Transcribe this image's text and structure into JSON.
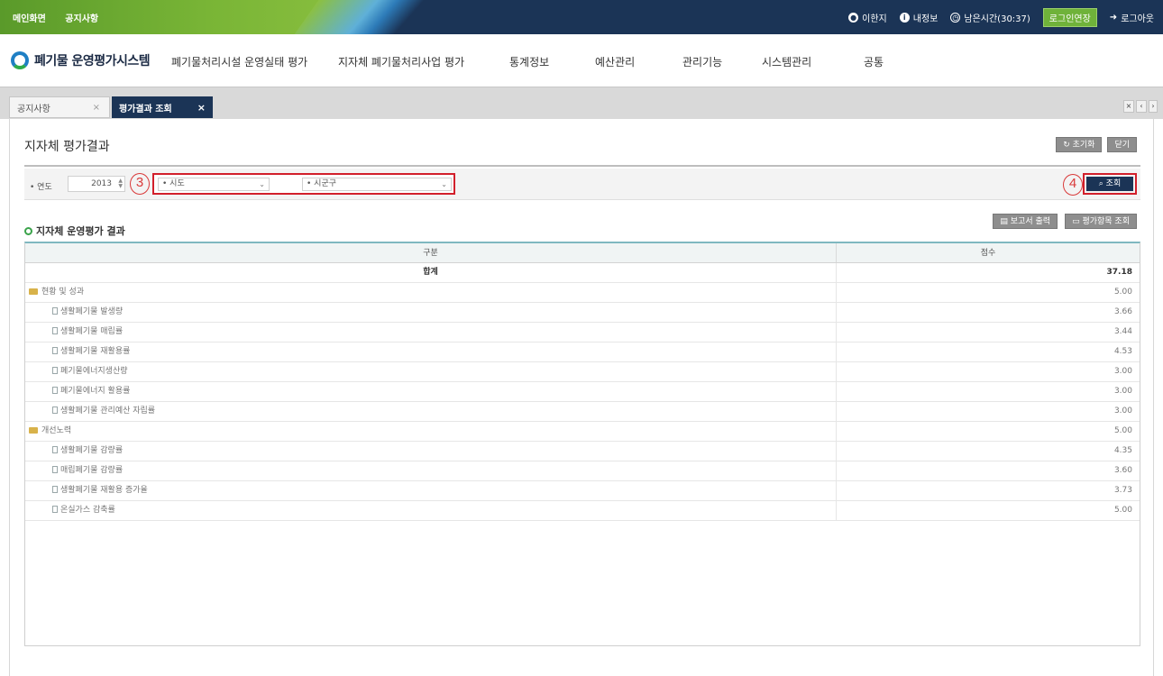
{
  "topbar": {
    "links": [
      "메인화면",
      "공지사항"
    ],
    "user": "이한지",
    "my_info": "내정보",
    "remaining_time": "남은시간(30:37)",
    "extend_login": "로그인연장",
    "logout": "로그아웃"
  },
  "header": {
    "logo_text": "폐기물 운영평가시스템",
    "menu": [
      "폐기물처리시설 운영실태 평가",
      "지자체 폐기물처리사업 평가",
      "통계정보",
      "예산관리",
      "관리기능",
      "시스템관리",
      "공통"
    ]
  },
  "tabs": [
    {
      "label": "공지사항",
      "active": false
    },
    {
      "label": "평가결과 조회",
      "active": true
    }
  ],
  "page": {
    "title": "지자체 평가결과",
    "btn_reset": "초기화",
    "btn_close": "닫기"
  },
  "search": {
    "year_label": "연도",
    "year_value": "2013",
    "sido_placeholder": "시도",
    "sigungu_placeholder": "시군구",
    "search_button": "조회",
    "annotation_3": "3",
    "annotation_4": "4"
  },
  "section": {
    "title": "지자체 운영평가 결과",
    "btn_report": "보고서 출력",
    "btn_items": "평가항목 조회"
  },
  "grid": {
    "col_category": "구분",
    "col_score": "점수",
    "total_label": "합계",
    "total_value": "37.18",
    "rows": [
      {
        "level": 1,
        "label": "현황 및 성과",
        "score": "5.00"
      },
      {
        "level": 2,
        "label": "생활폐기물 발생량",
        "score": "3.66"
      },
      {
        "level": 2,
        "label": "생활폐기물 매립률",
        "score": "3.44"
      },
      {
        "level": 2,
        "label": "생활폐기물 재활용률",
        "score": "4.53"
      },
      {
        "level": 2,
        "label": "폐기물에너지생산량",
        "score": "3.00"
      },
      {
        "level": 2,
        "label": "폐기물에너지 활용률",
        "score": "3.00"
      },
      {
        "level": 2,
        "label": "생활폐기물 관리예산 자립률",
        "score": "3.00"
      },
      {
        "level": 1,
        "label": "개선노력",
        "score": "5.00"
      },
      {
        "level": 2,
        "label": "생활폐기물 감량률",
        "score": "4.35"
      },
      {
        "level": 2,
        "label": "매립폐기물 감량률",
        "score": "3.60"
      },
      {
        "level": 2,
        "label": "생활폐기물 재활용 증가율",
        "score": "3.73"
      },
      {
        "level": 2,
        "label": "온실가스 감축률",
        "score": "5.00"
      }
    ]
  }
}
